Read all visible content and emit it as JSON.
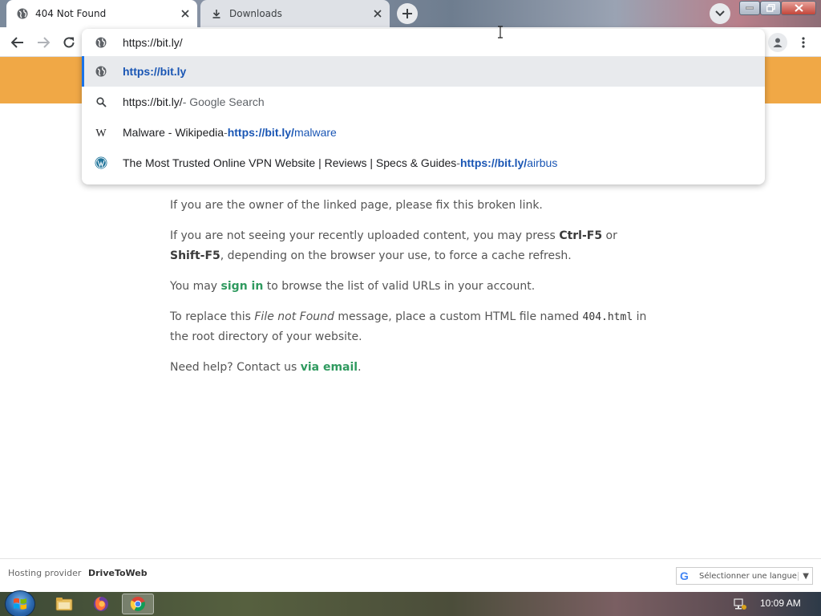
{
  "tabs": [
    {
      "label": "404 Not Found",
      "active": true,
      "icon": "globe-icon"
    },
    {
      "label": "Downloads",
      "active": false,
      "icon": "download-icon"
    }
  ],
  "omnibox": {
    "input_value": "https://bit.ly/",
    "suggestions": [
      {
        "icon": "globe-icon",
        "text": "",
        "url_bold": "https://bit.ly",
        "url_rest": "",
        "selected": true
      },
      {
        "icon": "search-icon",
        "text": "https://bit.ly/",
        "sep": " - Google Search",
        "url_bold": "",
        "url_rest": "",
        "selected": false
      },
      {
        "icon": "wikipedia-icon",
        "text": "Malware - Wikipedia",
        "sep": " - ",
        "url_bold": "https://bit.ly/",
        "url_rest": "malware",
        "selected": false
      },
      {
        "icon": "wordpress-icon",
        "text": "The Most Trusted Online VPN Website | Reviews | Specs & Guides",
        "sep": " - ",
        "url_bold": "https://bit.ly/",
        "url_rest": "airbus",
        "selected": false
      }
    ]
  },
  "page": {
    "p1": "If you are the owner of the linked page, please fix this broken link.",
    "p2_a": "If you are not seeing your recently uploaded content, you may press ",
    "p2_k1": "Ctrl-F5",
    "p2_b": " or ",
    "p2_k2": "Shift-F5",
    "p2_c": ", depending on the browser your use, to force a cache refresh.",
    "p3_a": "You may ",
    "p3_link": "sign in",
    "p3_b": " to browse the list of valid URLs in your account.",
    "p4_a": "To replace this ",
    "p4_em": "File not Found",
    "p4_b": " message, place a custom HTML file named ",
    "p4_code": "404.html",
    "p4_c": " in the root directory of your website.",
    "p5_a": "Need help? Contact us ",
    "p5_link": "via email",
    "p5_b": "."
  },
  "footer": {
    "label": "Hosting provider",
    "name": "DriveToWeb",
    "lang": "Sélectionner une langue",
    "lang_caret": "▼",
    "google_g": "G"
  },
  "taskbar": {
    "clock": "10:09 AM"
  },
  "colors": {
    "banner": "#f0a846",
    "link": "#2f9a5f",
    "url_blue": "#1a56b4"
  }
}
